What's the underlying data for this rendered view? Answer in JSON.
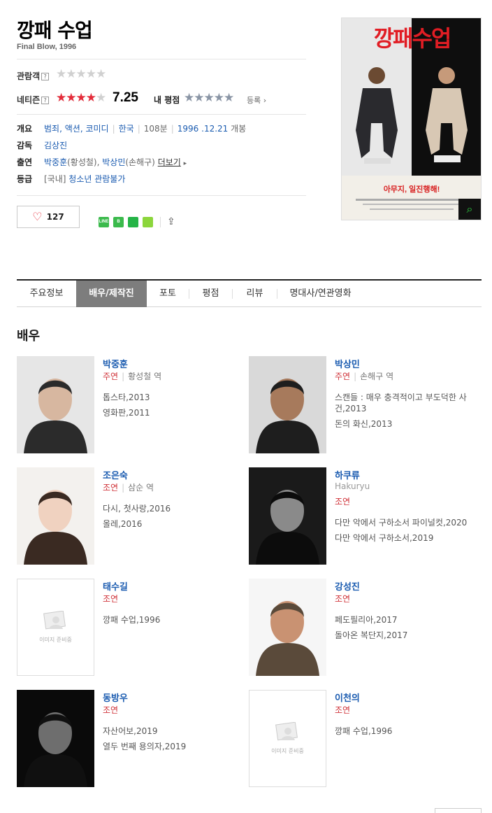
{
  "movie": {
    "title": "깡패 수업",
    "subtitle": "Final Blow, 1996"
  },
  "ratings": {
    "audience_label": "관람객",
    "netizen_label": "네티즌",
    "help_mark": "?",
    "netizen_score": "7.25",
    "netizen_fraction": 0.725,
    "my_rating_label": "내 평점",
    "register_label": "등록"
  },
  "info": {
    "overview_label": "개요",
    "genres": [
      "범죄",
      "액션",
      "코미디"
    ],
    "country": "한국",
    "runtime": "108분",
    "release_date": "1996 .12.21",
    "release_suffix": "개봉",
    "director_label": "감독",
    "director": "김상진",
    "cast_label": "출연",
    "cast": [
      {
        "name": "박중훈",
        "role": "(황성철)"
      },
      {
        "name": "박상민",
        "role": "(손해구)"
      }
    ],
    "cast_sep": ", ",
    "more_label": "더보기",
    "grade_label": "등급",
    "grade_prefix": "[국내]",
    "grade": "청소년 관람불가"
  },
  "actions": {
    "like_count": "127",
    "share_icons": [
      {
        "name": "line-share-icon",
        "color": "#3bba4c",
        "text": "LINE"
      },
      {
        "name": "band-share-icon",
        "color": "#3bba4c",
        "text": "B"
      },
      {
        "name": "bookmark-share-icon",
        "color": "#25b447",
        "text": ""
      },
      {
        "name": "memo-share-icon",
        "color": "#8cd63c",
        "text": ""
      }
    ]
  },
  "poster": {
    "title_text": "깡패수업",
    "tagline": "아무지, 일진행해!"
  },
  "tabs": [
    "주요정보",
    "배우/제작진",
    "포토",
    "평점",
    "리뷰",
    "명대사/연관영화"
  ],
  "active_tab": 1,
  "section_title": "배우",
  "placeholder_text": "이미지 준비중",
  "actors": [
    {
      "name": "박중훈",
      "eng": "",
      "kind": "주연",
      "role": "황성철 역",
      "works": [
        "톱스타,2013",
        "영화판,2011"
      ]
    },
    {
      "name": "박상민",
      "eng": "",
      "kind": "주연",
      "role": "손해구 역",
      "works": [
        "스캔들 : 매우 충격적이고 부도덕한 사건,2013",
        "돈의 화신,2013"
      ]
    },
    {
      "name": "조은숙",
      "eng": "",
      "kind": "조연",
      "role": "삼순 역",
      "works": [
        "다시, 첫사랑,2016",
        "올레,2016"
      ]
    },
    {
      "name": "하쿠류",
      "eng": "Hakuryu",
      "kind": "조연",
      "role": "",
      "works": [
        "다만 악에서 구하소서 파이널컷,2020",
        "다만 악에서 구하소서,2019"
      ]
    },
    {
      "name": "태수길",
      "eng": "",
      "kind": "조연",
      "role": "",
      "works": [
        "깡패 수업,1996"
      ]
    },
    {
      "name": "강성진",
      "eng": "",
      "kind": "조연",
      "role": "",
      "works": [
        "페도필리아,2017",
        "돌아온 복단지,2017"
      ]
    },
    {
      "name": "동방우",
      "eng": "",
      "kind": "조연",
      "role": "",
      "works": [
        "자산어보,2019",
        "열두 번째 용의자,2019"
      ]
    },
    {
      "name": "이천의",
      "eng": "",
      "kind": "조연",
      "role": "",
      "works": [
        "깡패 수업,1996"
      ]
    }
  ]
}
